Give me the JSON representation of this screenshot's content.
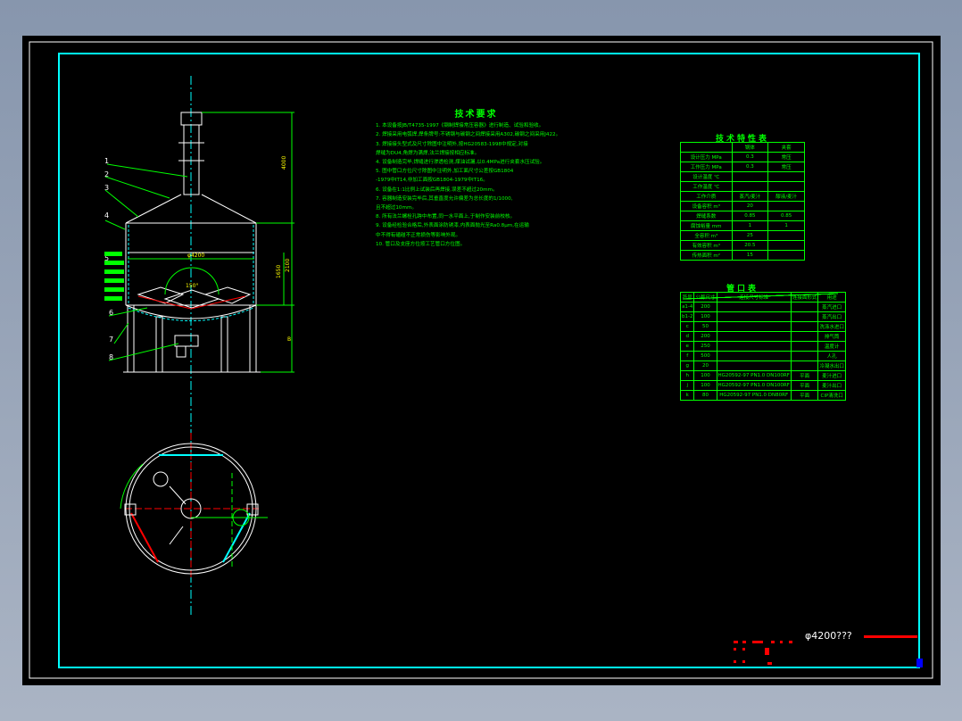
{
  "leaders": [
    "1",
    "2",
    "3",
    "4",
    "5",
    "6",
    "7",
    "8"
  ],
  "dimensions": {
    "total_height": "4000",
    "diameter": "φ4200",
    "shell_height": "1650",
    "jacket_height": "2100",
    "leg_height": "B",
    "angle": "150°"
  },
  "requirements": {
    "title": "技术要求",
    "items": [
      "1. 本设备按JB/T4735-1997《钢制焊接常压容器》进行制造、试验和验收。",
      "2. 焊接采用电弧焊,焊条牌号:不锈钢与碳钢之间焊接采用A302,碳钢之间采用J422。",
      "3. 焊接接头型式及尺寸除图中注明外,按HG20583-1998中规定,对接",
      "   焊缝为DU4,角焊为满焊,法兰焊接按相应标准。",
      "4. 设备制造完毕,焊缝进行渗透检测,煤油试漏,以0.4MPa进行夹套水压试验。",
      "5. 图中管口方位尺寸除图中注明外,加工面尺寸公差按GB1804",
      "   -1979中IT14,非加工面按GB1804-1979中IT16。",
      "6. 设备在1:1比例上试装后再焊接,误差不超过20mm。",
      "7. 容器制造安装完毕后,其垂直度允许偏差为总长度的1/1000,",
      "   且不超过10mm。",
      "8. 所有法兰螺栓孔跨中布置,同一水平面上,于制作安装前校核。",
      "9. 设备经检验合格后,外表面涂防锈漆,内表面抛光至Ra0.8μm,在运输",
      "   中不得有磕碰不正常损伤等影响外观。",
      "10. 管口及支座方位按工艺管口方位图。"
    ]
  },
  "tech_table": {
    "title": "技术特性表",
    "headers": [
      "",
      "锅体",
      "夹套"
    ],
    "rows": [
      [
        "设计压力 MPa",
        "0.3",
        "常压"
      ],
      [
        "工作压力 MPa",
        "0.3",
        "常压"
      ],
      [
        "设计温度 ℃",
        "",
        ""
      ],
      [
        "工作温度 ℃",
        "",
        ""
      ],
      [
        "工作介质",
        "蒸汽/麦汁",
        "醪液/麦汁"
      ],
      [
        "设备容积 m³",
        "20",
        ""
      ],
      [
        "焊缝系数",
        "0.85",
        "0.85"
      ],
      [
        "腐蚀裕量 mm",
        "1",
        "1"
      ],
      [
        "全容积 m³",
        "25",
        ""
      ],
      [
        "有效容积 m³",
        "20.5",
        ""
      ],
      [
        "传热面积 m²",
        "15",
        ""
      ]
    ]
  },
  "nozzle_table": {
    "title": "管口表",
    "headers": [
      "符号",
      "公称尺寸",
      "连接尺寸标准",
      "连接面形式",
      "用途"
    ],
    "rows": [
      [
        "a1-4",
        "200",
        "",
        "",
        "蒸汽进口"
      ],
      [
        "b1-2",
        "100",
        "",
        "",
        "蒸汽出口"
      ],
      [
        "c",
        "50",
        "",
        "",
        "洗涤水进口"
      ],
      [
        "d",
        "200",
        "",
        "",
        "排气筒"
      ],
      [
        "e",
        "250",
        "",
        "",
        "温度计"
      ],
      [
        "f",
        "500",
        "",
        "",
        "人孔"
      ],
      [
        "g",
        "20",
        "",
        "",
        "冷凝水出口"
      ],
      [
        "h",
        "100",
        "HG20592-97 PN1.0 DN100RF",
        "平面",
        "麦汁进口"
      ],
      [
        "j",
        "100",
        "HG20592-97 PN1.0 DN100RF",
        "平面",
        "麦汁出口"
      ],
      [
        "k",
        "80",
        "HG20592-97 PN1.0 DN80RF",
        "平面",
        "CIP清洗口"
      ]
    ]
  },
  "title_block": {
    "name": "φ4200???"
  },
  "colors": {
    "background": "#000000",
    "frame": "#00ffff",
    "text": "#00ff00",
    "outline": "#ffffff",
    "centerline": "#00ffff",
    "annotation": "#ff0000"
  }
}
